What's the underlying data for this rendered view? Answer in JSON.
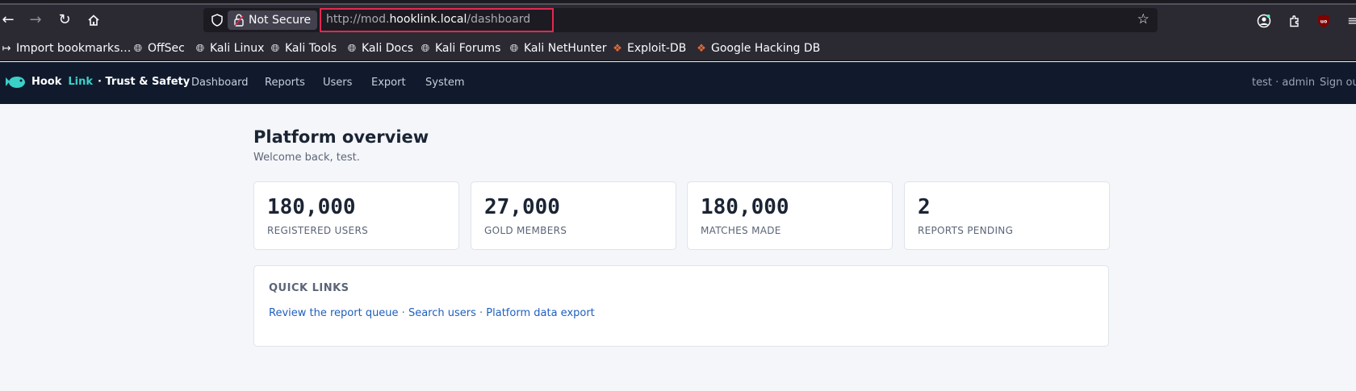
{
  "browser": {
    "not_secure_label": "Not Secure",
    "url_scheme": "http://mod.",
    "url_host": "hooklink.local",
    "url_path": "/dashboard",
    "accent_color": "#e22850"
  },
  "bookmarks": [
    {
      "label": "Import bookmarks…",
      "icon": "import-icon"
    },
    {
      "label": "OffSec",
      "icon": "globe-icon"
    },
    {
      "label": "Kali Linux",
      "icon": "globe-icon"
    },
    {
      "label": "Kali Tools",
      "icon": "globe-icon"
    },
    {
      "label": "Kali Docs",
      "icon": "globe-icon"
    },
    {
      "label": "Kali Forums",
      "icon": "globe-icon"
    },
    {
      "label": "Kali NetHunter",
      "icon": "globe-icon"
    },
    {
      "label": "Exploit-DB",
      "icon": "flame-icon"
    },
    {
      "label": "Google Hacking DB",
      "icon": "flame-icon"
    }
  ],
  "app": {
    "brand_hook": "Hook",
    "brand_link": "Link",
    "brand_suffix": "· Trust & Safety",
    "brand_color": "#3ad0c8",
    "nav": [
      "Dashboard",
      "Reports",
      "Users",
      "Export",
      "System"
    ],
    "user_label": "test · admin",
    "signout_label": "Sign out"
  },
  "main": {
    "title": "Platform overview",
    "welcome": "Welcome back, test.",
    "stats": [
      {
        "value": "180,000",
        "label": "REGISTERED USERS"
      },
      {
        "value": "27,000",
        "label": "GOLD MEMBERS"
      },
      {
        "value": "180,000",
        "label": "MATCHES MADE"
      },
      {
        "value": "2",
        "label": "REPORTS PENDING"
      }
    ],
    "quick_links": {
      "title": "QUICK LINKS",
      "links": [
        "Review the report queue",
        "Search users",
        "Platform data export"
      ],
      "separator": " · "
    }
  }
}
